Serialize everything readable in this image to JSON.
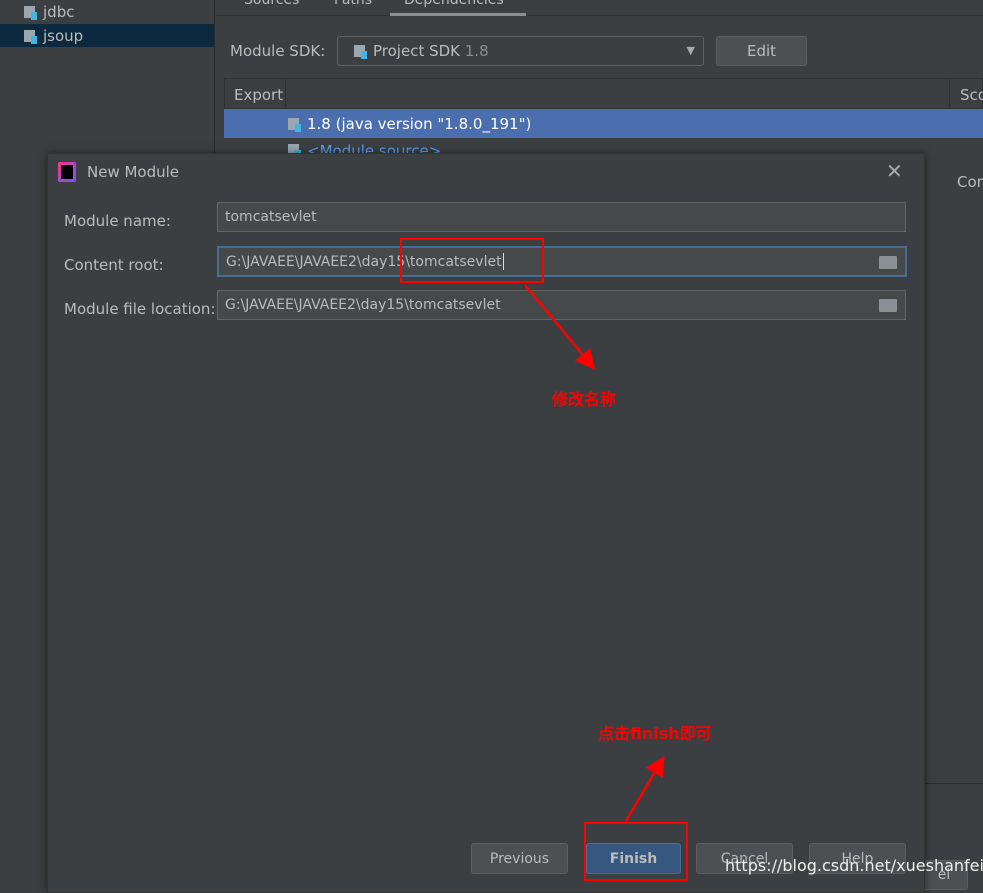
{
  "sidebar": {
    "items": [
      {
        "label": "jdbc",
        "selected": false
      },
      {
        "label": "jsoup",
        "selected": true
      }
    ]
  },
  "tabs": [
    "Sources",
    "Paths",
    "Dependencies"
  ],
  "module_sdk": {
    "label": "Module SDK:",
    "value": "Project SDK",
    "version": "1.8",
    "edit": "Edit"
  },
  "deps_table": {
    "headers": [
      "Export",
      "Sco"
    ],
    "rows": [
      "1.8 (java version \"1.8.0_191\")",
      "<Module source>"
    ]
  },
  "bg_partial": {
    "right_label": "Cor",
    "cancel_partial": "el"
  },
  "dialog": {
    "title": "New Module",
    "fields": [
      {
        "label": "Module name:",
        "value": "tomcatsevlet"
      },
      {
        "label": "Content root:",
        "value": "G:\\JAVAEE\\JAVAEE2\\day15\\tomcatsevlet"
      },
      {
        "label": "Module file location:",
        "value": "G:\\JAVAEE\\JAVAEE2\\day15\\tomcatsevlet"
      }
    ],
    "buttons": {
      "previous": "Previous",
      "finish": "Finish",
      "cancel": "Cancel",
      "help": "Help"
    }
  },
  "annotations": {
    "rename": "修改名称",
    "click_finish": "点击finish即可",
    "color": "#ff0000"
  },
  "watermark": "https://blog.csdn.net/xueshanfeitian",
  "colors": {
    "bg": "#3c3f41",
    "selection": "#4b6eaf",
    "tree_selection": "#0d293e",
    "finish": "#365880"
  }
}
